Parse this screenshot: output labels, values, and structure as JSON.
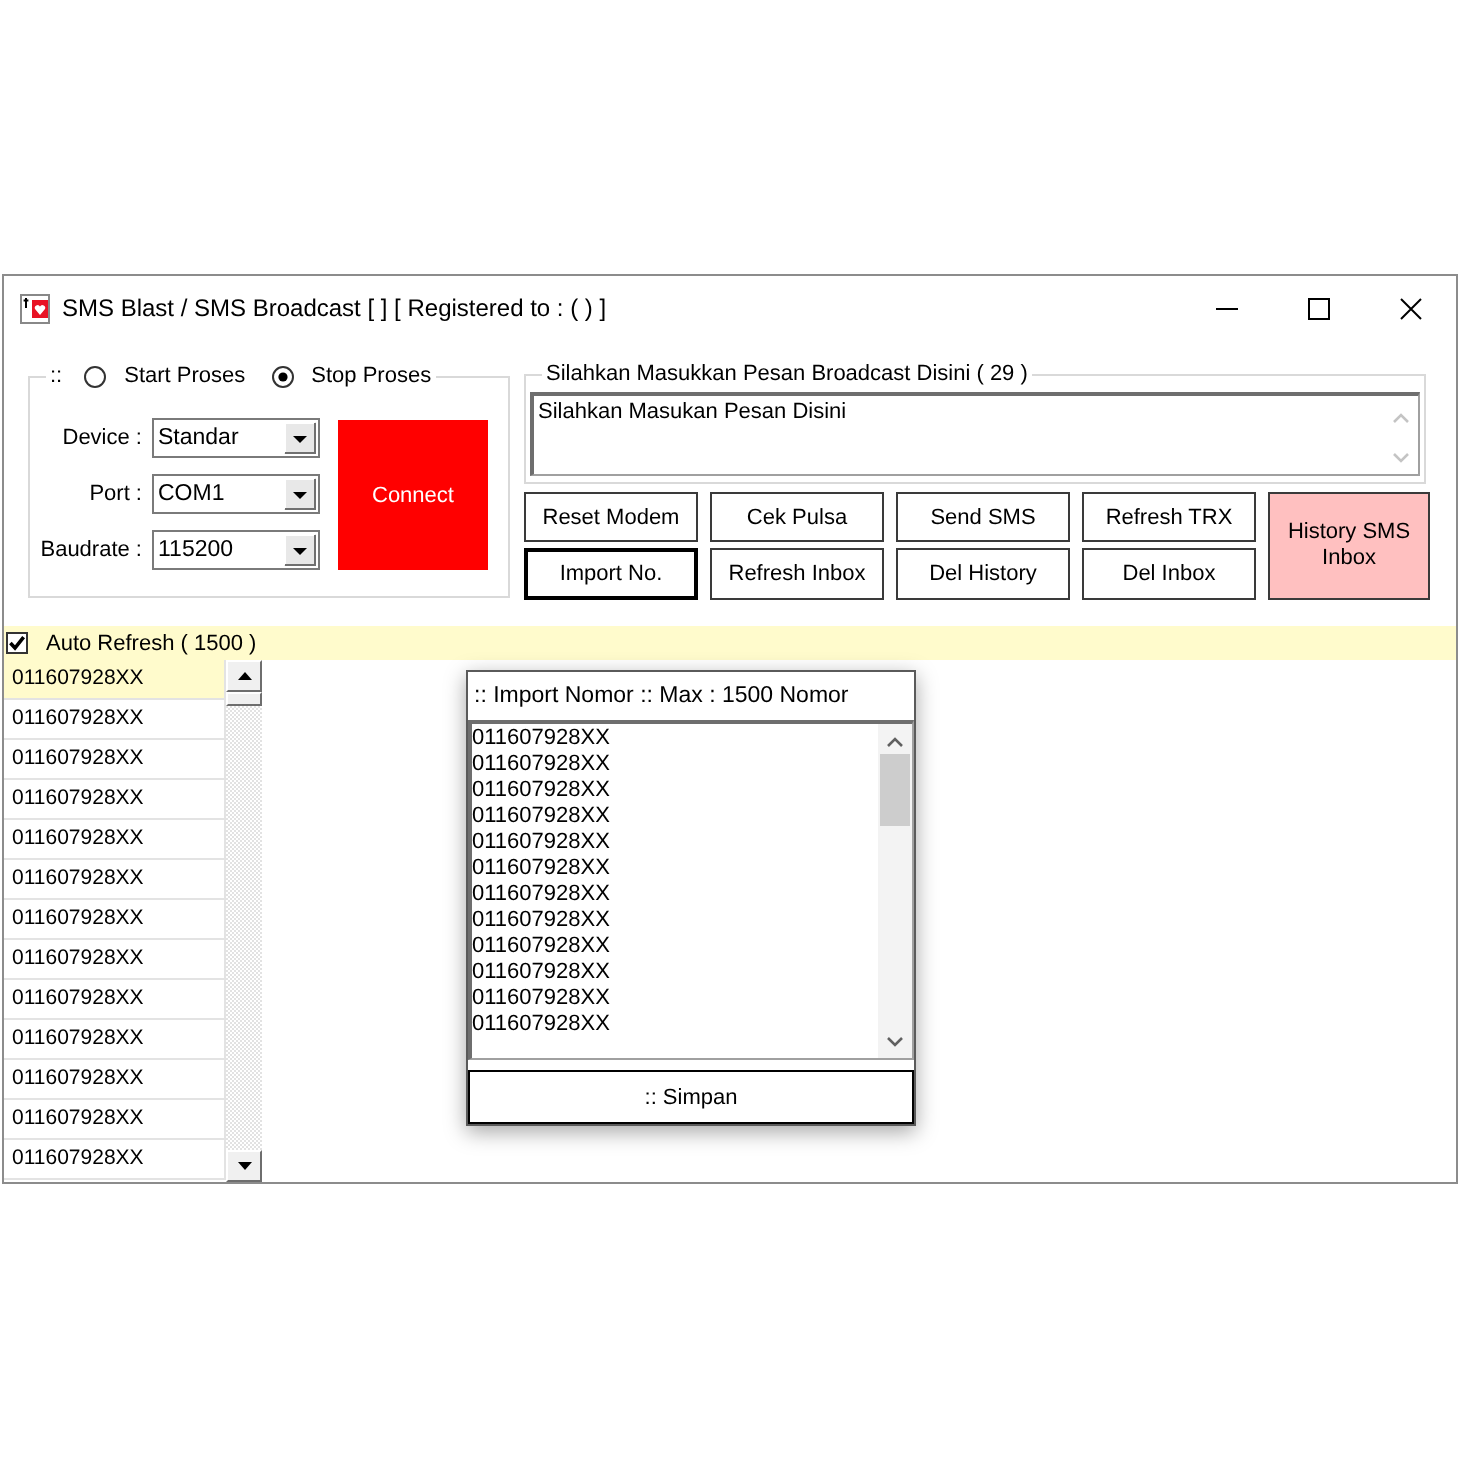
{
  "window": {
    "title": "SMS Blast / SMS Broadcast [ ] [ Registered to : ( ) ]"
  },
  "process_group": {
    "label": "::",
    "options": [
      {
        "label": "Start Proses",
        "selected": false
      },
      {
        "label": "Stop Proses",
        "selected": true
      }
    ],
    "settings": [
      {
        "label": "Device :",
        "value": "Standar"
      },
      {
        "label": "Port :",
        "value": "COM1"
      },
      {
        "label": "Baudrate :",
        "value": "115200"
      }
    ],
    "connect_button": "Connect"
  },
  "message_group": {
    "label": "Silahkan Masukkan Pesan Broadcast Disini ( 29 )",
    "value": "Silahkan Masukan Pesan Disini"
  },
  "buttons": [
    {
      "label": "Reset Modem",
      "focused": false
    },
    {
      "label": "Cek Pulsa",
      "focused": false
    },
    {
      "label": "Send SMS",
      "focused": false
    },
    {
      "label": "Refresh TRX",
      "focused": false
    },
    {
      "label": "Import No.",
      "focused": true
    },
    {
      "label": "Refresh Inbox",
      "focused": false
    },
    {
      "label": "Del History",
      "focused": false
    },
    {
      "label": "Del Inbox",
      "focused": false
    }
  ],
  "history_button": "History SMS Inbox",
  "auto_refresh": {
    "label": "Auto Refresh ( 1500 )",
    "checked": true
  },
  "numbers": [
    {
      "text": "011607928XX",
      "selected": true
    },
    {
      "text": "011607928XX",
      "selected": false
    },
    {
      "text": "011607928XX",
      "selected": false
    },
    {
      "text": "011607928XX",
      "selected": false
    },
    {
      "text": "011607928XX",
      "selected": false
    },
    {
      "text": "011607928XX",
      "selected": false
    },
    {
      "text": "011607928XX",
      "selected": false
    },
    {
      "text": "011607928XX",
      "selected": false
    },
    {
      "text": "011607928XX",
      "selected": false
    },
    {
      "text": "011607928XX",
      "selected": false
    },
    {
      "text": "011607928XX",
      "selected": false
    },
    {
      "text": "011607928XX",
      "selected": false
    },
    {
      "text": "011607928XX",
      "selected": false
    }
  ],
  "import_dialog": {
    "title": ":: Import Nomor :: Max : 1500 Nomor",
    "lines": [
      "011607928XX",
      "011607928XX",
      "011607928XX",
      "011607928XX",
      "011607928XX",
      "011607928XX",
      "011607928XX",
      "011607928XX",
      "011607928XX",
      "011607928XX",
      "011607928XX",
      "011607928XX"
    ],
    "save_button": ":: Simpan"
  }
}
